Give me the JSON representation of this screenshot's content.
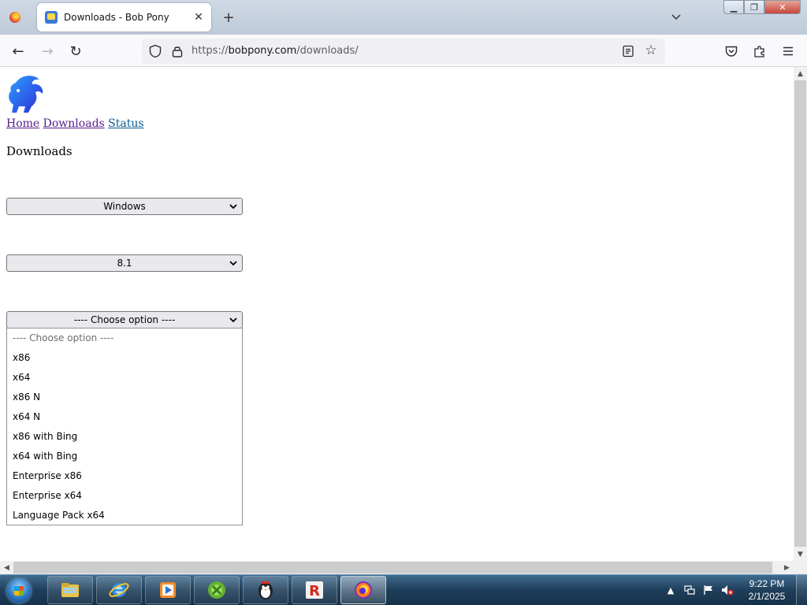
{
  "browser": {
    "tab_title": "Downloads - Bob Pony",
    "tab_close_glyph": "✕",
    "new_tab_glyph": "+",
    "tab_list_glyph": "⌄",
    "window_controls": {
      "minimize": "▁",
      "maximize": "❐",
      "close": "✕"
    }
  },
  "navbar": {
    "back_glyph": "←",
    "forward_glyph": "→",
    "reload_glyph": "↻",
    "url_scheme": "https://",
    "url_host": "bobpony.com",
    "url_path": "/downloads/"
  },
  "page": {
    "nav_links": [
      "Home",
      "Downloads",
      "Status"
    ],
    "heading": "Downloads",
    "selects": {
      "os": "Windows",
      "version": "8.1",
      "edition": "---- Choose option ----"
    },
    "dropdown_options": [
      "---- Choose option ----",
      "x86",
      "x64",
      "x86 N",
      "x64 N",
      "x86 with Bing",
      "x64 with Bing",
      "Enterprise x86",
      "Enterprise x64",
      "Language Pack x64"
    ]
  },
  "taskbar": {
    "items": [
      "explorer",
      "internet-explorer",
      "media-player",
      "xbox",
      "penguin-app",
      "roblox",
      "firefox"
    ],
    "active_item": "firefox",
    "clock_time": "9:22 PM",
    "clock_date": "2/1/2025"
  },
  "colors": {
    "visited_link": "#551a8b",
    "accent_firefox": "#ff7a1a",
    "taskbar": "#1f3e5a"
  }
}
